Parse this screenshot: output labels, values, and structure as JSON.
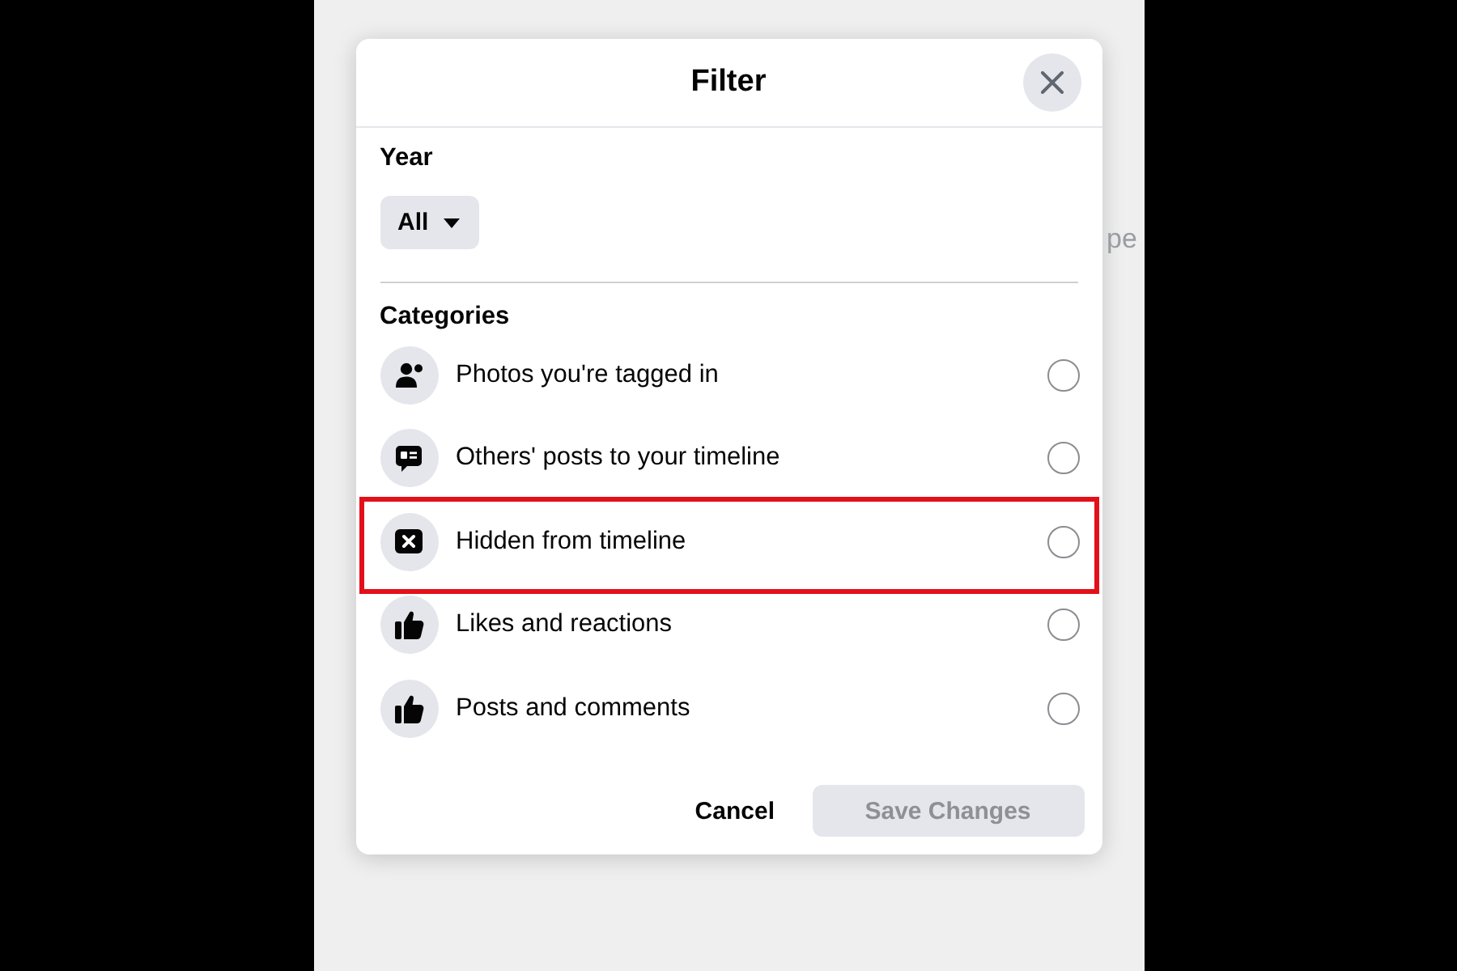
{
  "background_text": "pe",
  "dialog": {
    "title": "Filter",
    "year": {
      "label": "Year",
      "dropdown": {
        "value": "All"
      }
    },
    "categories": {
      "label": "Categories",
      "items": [
        {
          "label": "Photos you're tagged in",
          "kind": "tag",
          "selected": false,
          "highlighted": false
        },
        {
          "label": "Others' posts to your timeline",
          "kind": "message",
          "selected": false,
          "highlighted": false
        },
        {
          "label": "Hidden from timeline",
          "kind": "hidden",
          "selected": false,
          "highlighted": true
        },
        {
          "label": "Likes and reactions",
          "kind": "like",
          "selected": false,
          "highlighted": false
        },
        {
          "label": "Posts and comments",
          "kind": "like",
          "selected": false,
          "highlighted": false
        }
      ]
    },
    "buttons": [
      {
        "label": "Cancel",
        "kind": "text",
        "disabled": false
      },
      {
        "label": "Save Changes",
        "kind": "filled",
        "disabled": true
      }
    ]
  }
}
